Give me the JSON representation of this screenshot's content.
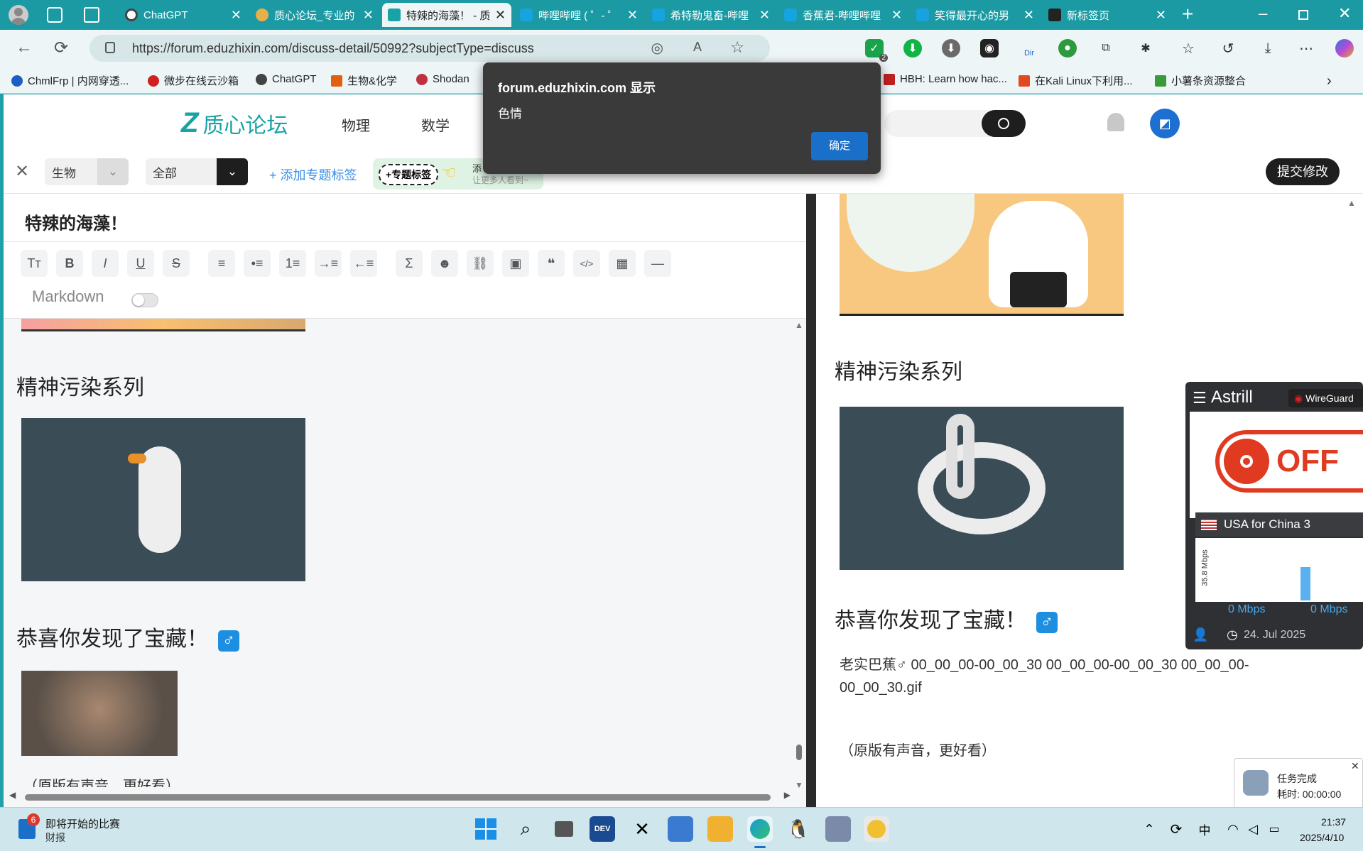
{
  "tabs": [
    {
      "label": "ChatGPT",
      "color": "#444"
    },
    {
      "label": "质心论坛_专业的",
      "color": "#e8b04a"
    },
    {
      "label": "特辣的海藻！ - 质",
      "color": "#18a3a6"
    },
    {
      "label": "哔哩哔哩 ( ゜- ゜",
      "color": "#16a3e0"
    },
    {
      "label": "希特勒鬼畜-哔哩",
      "color": "#16a3e0"
    },
    {
      "label": "香蕉君-哔哩哔哩",
      "color": "#16a3e0"
    },
    {
      "label": "笑得最开心的男",
      "color": "#16a3e0"
    },
    {
      "label": "新标签页",
      "color": "#222"
    }
  ],
  "address": {
    "url": "https://forum.eduzhixin.com/discuss-detail/50992?subjectType=discuss"
  },
  "extension_badge": "2",
  "extension_dir": "Dir",
  "bookmarks": [
    {
      "label": "ChmlFrp | 内网穿透...",
      "color": "#1b5fc4"
    },
    {
      "label": "微步在线云沙箱",
      "color": "#d02020"
    },
    {
      "label": "ChatGPT",
      "color": "#444"
    },
    {
      "label": "生物&化学",
      "color": "#e06010"
    },
    {
      "label": "Shodan",
      "color": "#c03040"
    },
    {
      "label": "HBH: Learn how hac...",
      "color": "#c02020"
    },
    {
      "label": "在Kali Linux下利用...",
      "color": "#e04a20"
    },
    {
      "label": "小薯条资源整合",
      "color": "#3a9a3a"
    }
  ],
  "site": {
    "logo": "质心论坛",
    "nav": [
      "物理",
      "数学"
    ],
    "submit": "提交修改"
  },
  "editor": {
    "subject": "生物",
    "scope": "全部",
    "add_tag": "+ 添加专题标签",
    "topic_tag": "+专题标签",
    "promo_line1": "添",
    "promo_line2": "让更多人看到~",
    "title": "特辣的海藻！",
    "markdown": "Markdown"
  },
  "left_content": {
    "h1": "精神污染系列",
    "h2": "恭喜你发现了宝藏！",
    "h2_icon": "♂",
    "caption": "（原版有声音，更好看）"
  },
  "right_content": {
    "h1": "精神污染系列",
    "h2": "恭喜你发现了宝藏！",
    "h2_icon": "♂",
    "broken_img_alt": "老实巴蕉♂ 00_00_00-00_00_30 00_00_00-00_00_30 00_00_00-00_00_30.gif",
    "caption": "（原版有声音，更好看）"
  },
  "alert": {
    "title": "forum.eduzhixin.com 显示",
    "message": "色情",
    "ok": "确定"
  },
  "astrill": {
    "brand": "Astrill",
    "protocol": "WireGuard",
    "state": "OFF",
    "server": "USA for China 3",
    "axis": "35.8 Mbps",
    "down": "0 Mbps",
    "up": "0 Mbps",
    "date": "24. Jul 2025"
  },
  "notification": {
    "title": "任务完成",
    "detail": "耗时: 00:00:00"
  },
  "taskbar": {
    "news_badge": "6",
    "news_title": "即将开始的比赛",
    "news_sub": "财报",
    "ime": "中",
    "time": "21:37",
    "date": "2025/4/10"
  }
}
